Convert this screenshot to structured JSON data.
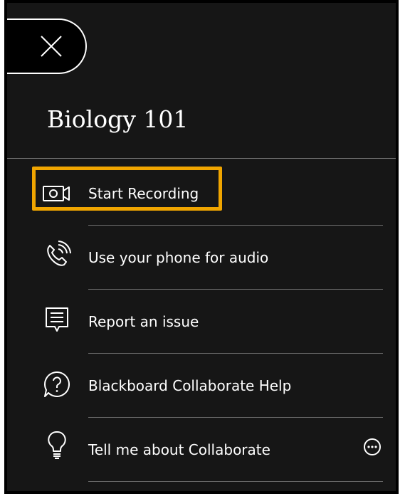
{
  "panel": {
    "title": "Biology 101"
  },
  "menu": {
    "items": [
      {
        "label": "Start Recording",
        "icon": "video-camera-icon"
      },
      {
        "label": "Use your phone for audio",
        "icon": "phone-audio-icon"
      },
      {
        "label": "Report an issue",
        "icon": "report-issue-icon"
      },
      {
        "label": "Blackboard Collaborate Help",
        "icon": "help-icon"
      },
      {
        "label": "Tell me about Collaborate",
        "icon": "lightbulb-icon"
      }
    ]
  },
  "colors": {
    "panel_background": "#161616",
    "highlight": "#f0a500",
    "text": "#ffffff"
  }
}
